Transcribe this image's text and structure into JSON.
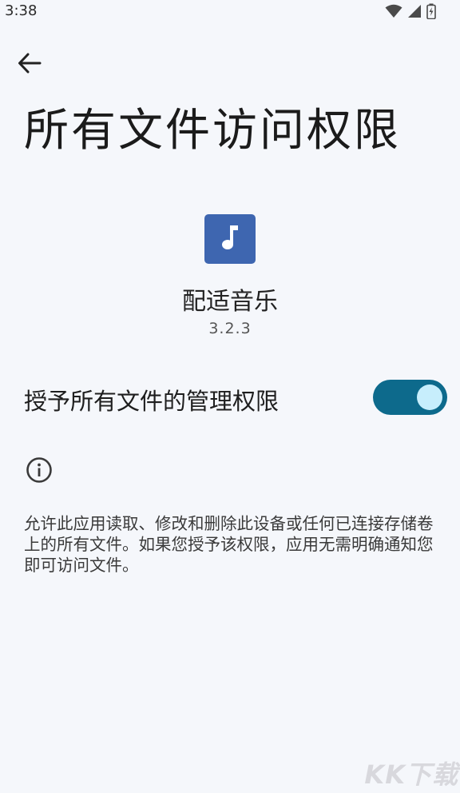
{
  "status_bar": {
    "time": "3:38",
    "icons": [
      "wifi-icon",
      "signal-icon",
      "battery-icon"
    ]
  },
  "header": {
    "back_icon": "arrow-back-icon",
    "title": "所有文件访问权限"
  },
  "app": {
    "icon": "music-note-icon",
    "icon_color": "#3e66b0",
    "name": "配适音乐",
    "version": "3.2.3"
  },
  "permission": {
    "label": "授予所有文件的管理权限",
    "enabled": true,
    "switch_color": "#0d6a8c"
  },
  "info": {
    "icon": "info-icon",
    "text": "允许此应用读取、修改和删除此设备或任何已连接存储卷上的所有文件。如果您授予该权限，应用无需明确通知您即可访问文件。"
  },
  "watermark": "KK下载"
}
